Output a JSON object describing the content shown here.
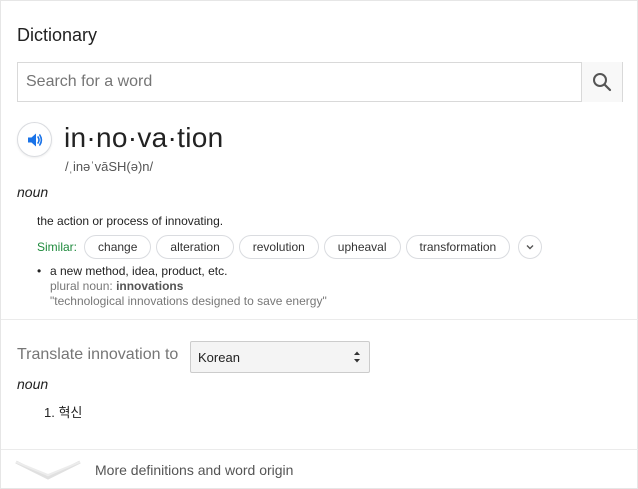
{
  "header": {
    "title": "Dictionary"
  },
  "search": {
    "placeholder": "Search for a word"
  },
  "entry": {
    "word": "in·no·va·tion",
    "phonetic": "/ˌinəˈvāSH(ə)n/",
    "part_of_speech": "noun",
    "definition": "the action or process of innovating.",
    "similar_label": "Similar:",
    "similar": [
      "change",
      "alteration",
      "revolution",
      "upheaval",
      "transformation"
    ],
    "sense2": {
      "definition": "a new method, idea, product, etc.",
      "plural_label": "plural noun:",
      "plural_value": "innovations",
      "example": "\"technological innovations designed to save energy\""
    }
  },
  "translate": {
    "label": "Translate innovation to",
    "selected_language": "Korean",
    "part_of_speech": "noun",
    "items": [
      "1. 혁신"
    ]
  },
  "footer": {
    "more_label": "More definitions and word origin"
  },
  "colors": {
    "accent": "#1a73e8",
    "similar_green": "#1e8a3c",
    "border": "#d9d9d9"
  },
  "icons": {
    "search": "search-icon",
    "speaker": "speaker-icon",
    "chevron": "chevron-down-icon"
  }
}
